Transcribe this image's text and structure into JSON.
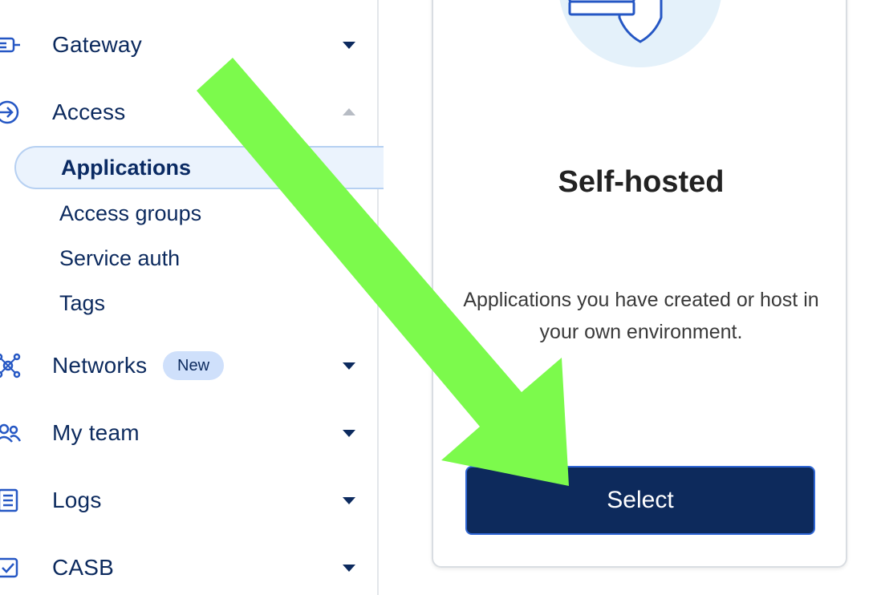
{
  "sidebar": {
    "items": [
      {
        "label": "Gateway",
        "icon": "gateway-icon"
      },
      {
        "label": "Access",
        "icon": "access-icon"
      },
      {
        "label": "Networks",
        "icon": "networks-icon",
        "badge": "New"
      },
      {
        "label": "My team",
        "icon": "team-icon"
      },
      {
        "label": "Logs",
        "icon": "logs-icon"
      },
      {
        "label": "CASB",
        "icon": "casb-icon"
      }
    ],
    "access_subitems": [
      {
        "label": "Applications",
        "active": true
      },
      {
        "label": "Access groups",
        "active": false
      },
      {
        "label": "Service auth",
        "active": false
      },
      {
        "label": "Tags",
        "active": false
      }
    ]
  },
  "card": {
    "title": "Self-hosted",
    "description": "Applications you have created or host in your own environment.",
    "button_label": "Select",
    "illustration": "shield-server-icon"
  },
  "colors": {
    "nav_text": "#0c2a5e",
    "active_bg": "#ebf3fd",
    "badge_bg": "#cfe0fb",
    "button_bg": "#0d2a5c",
    "button_border": "#2f66d4",
    "arrow": "#7cfa4c"
  }
}
